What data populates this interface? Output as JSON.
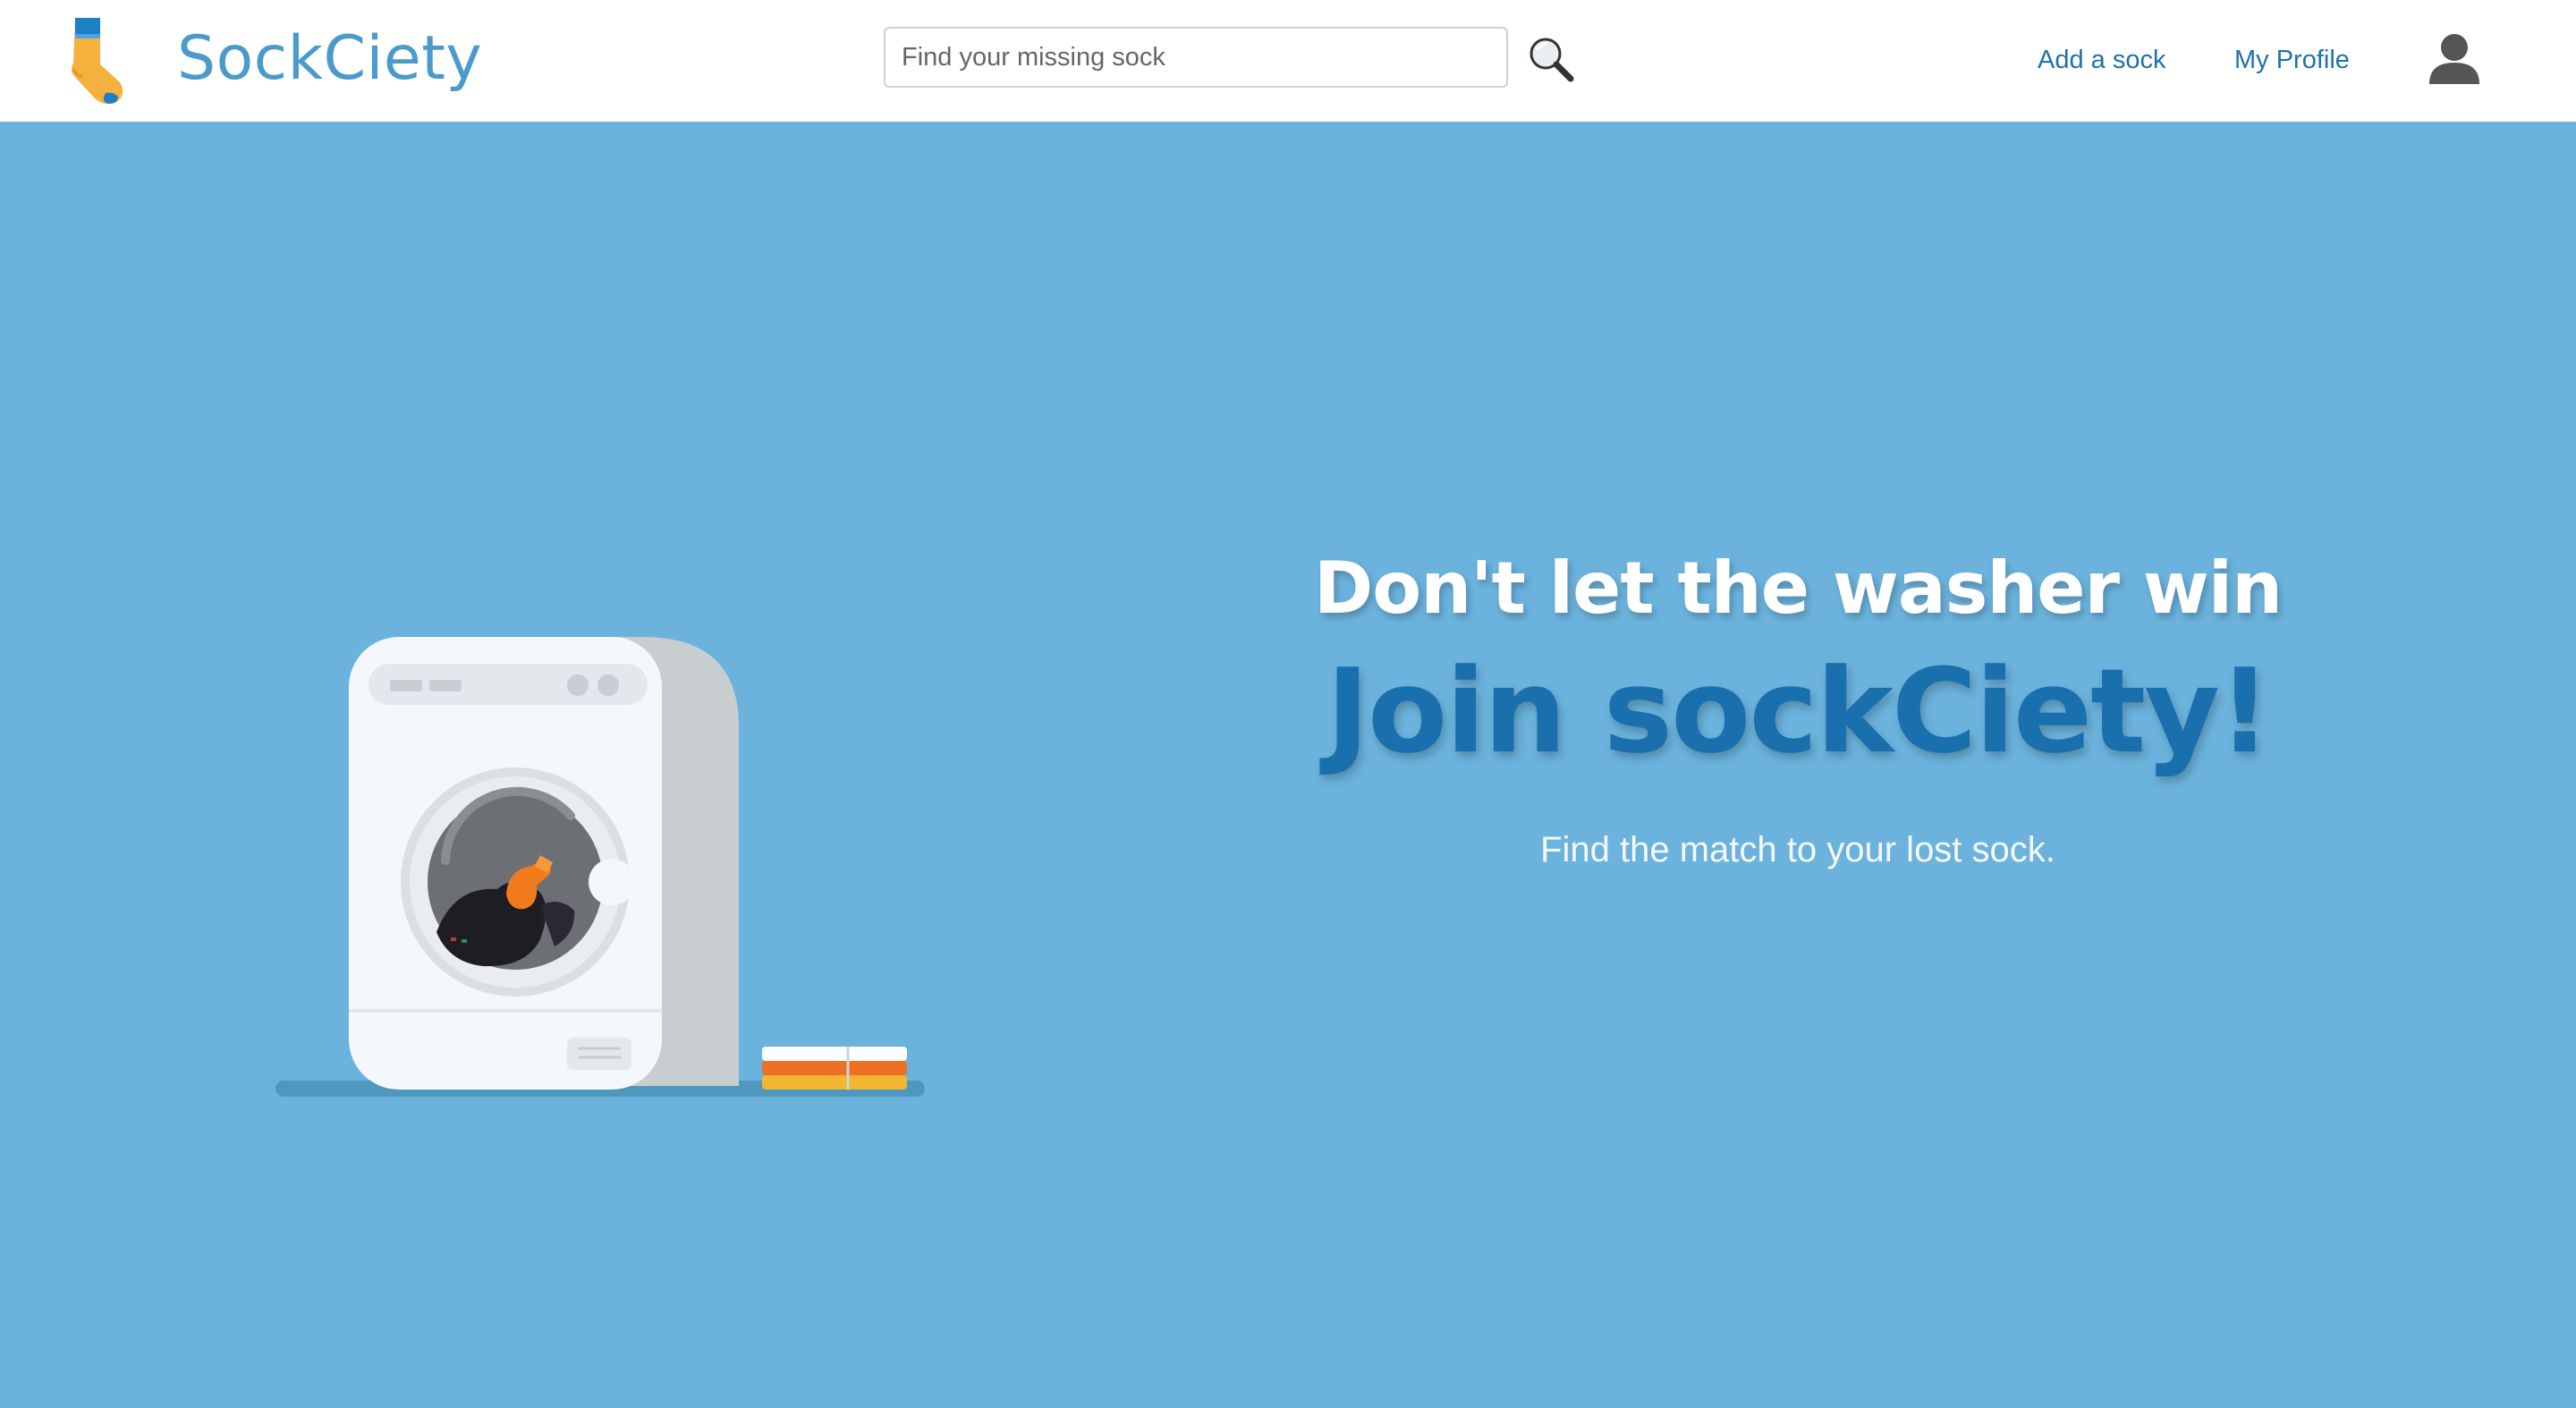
{
  "header": {
    "brand": "SockCiety",
    "search": {
      "placeholder": "Find your missing sock",
      "value": ""
    },
    "nav": [
      {
        "label": "Add a sock"
      },
      {
        "label": "My Profile"
      }
    ]
  },
  "icons": {
    "logo": "sock-icon",
    "search": "magnifier-icon",
    "profile": "user-silhouette-icon"
  },
  "hero": {
    "tagline": "Don't let the washer win",
    "headline": "Join sockCiety!",
    "subtext": "Find the match to your lost sock.",
    "illustration": "washing-machine-with-sock"
  },
  "colors": {
    "hero_background": "#6bb3dd",
    "brand": "#4a9bcb",
    "link": "#1f72aa",
    "headline": "#1a70ad",
    "tagline": "#ffffff"
  }
}
